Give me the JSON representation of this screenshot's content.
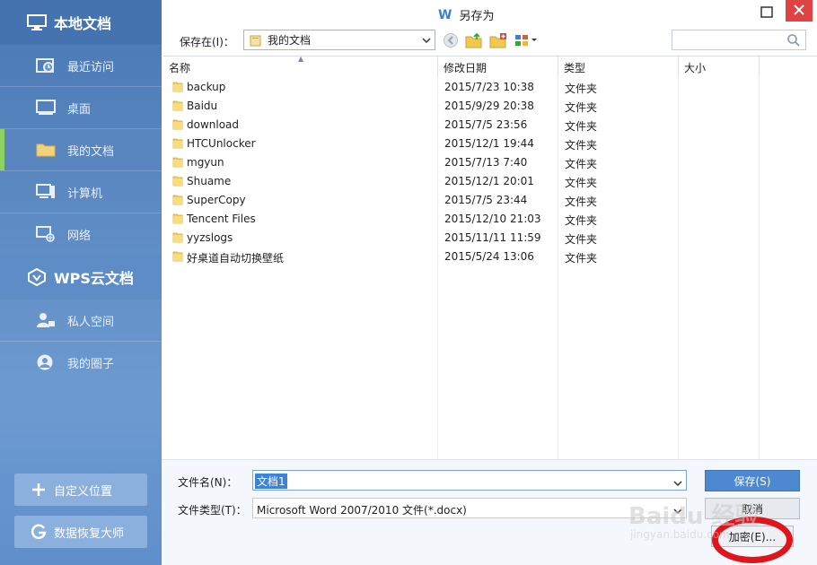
{
  "sidebar": {
    "local_title": "本地文档",
    "items": [
      {
        "label": "最近访问",
        "icon": "clock-icon"
      },
      {
        "label": "桌面",
        "icon": "monitor-icon"
      },
      {
        "label": "我的文档",
        "icon": "folder-icon",
        "active": true
      },
      {
        "label": "计算机",
        "icon": "computer-icon"
      },
      {
        "label": "网络",
        "icon": "network-icon"
      }
    ],
    "cloud_title": "WPS云文档",
    "cloud_items": [
      {
        "label": "私人空间",
        "icon": "user-lock-icon"
      },
      {
        "label": "我的圈子",
        "icon": "user-circle-icon"
      }
    ],
    "custom_location": "自定义位置",
    "data_recovery": "数据恢复大师"
  },
  "dialog": {
    "title": "另存为",
    "logo": "W"
  },
  "toolbar": {
    "save_in_label": "保存在(I)：",
    "current_folder": "我的文档"
  },
  "columns": {
    "name": "名称",
    "modified": "修改日期",
    "type": "类型",
    "size": "大小"
  },
  "files": [
    {
      "name": "backup",
      "modified": "2015/7/23 10:38",
      "type": "文件夹"
    },
    {
      "name": "Baidu",
      "modified": "2015/9/29 20:38",
      "type": "文件夹"
    },
    {
      "name": "download",
      "modified": "2015/7/5 23:56",
      "type": "文件夹"
    },
    {
      "name": "HTCUnlocker",
      "modified": "2015/12/1 19:44",
      "type": "文件夹"
    },
    {
      "name": "mgyun",
      "modified": "2015/7/13 7:40",
      "type": "文件夹"
    },
    {
      "name": "Shuame",
      "modified": "2015/12/1 20:01",
      "type": "文件夹"
    },
    {
      "name": "SuperCopy",
      "modified": "2015/7/5 23:44",
      "type": "文件夹"
    },
    {
      "name": "Tencent Files",
      "modified": "2015/12/10 21:03",
      "type": "文件夹"
    },
    {
      "name": "yyzslogs",
      "modified": "2015/11/11 11:59",
      "type": "文件夹"
    },
    {
      "name": "好桌道自动切换壁纸",
      "modified": "2015/5/24 13:06",
      "type": "文件夹"
    }
  ],
  "bottom": {
    "filename_label": "文件名(N)：",
    "filename_value": "文档1",
    "filetype_label": "文件类型(T)：",
    "filetype_value": "Microsoft Word 2007/2010 文件(*.docx)",
    "save_button": "保存(S)",
    "cancel_button": "取消",
    "encrypt_button": "加密(E)..."
  },
  "watermark": {
    "text": "Baidu 经验",
    "sub": "jingyan.baidu.com"
  },
  "colors": {
    "sidebar_bg": "#4a78b3",
    "active_marker": "#8dd35f",
    "save_button": "#4e88d0",
    "close_button": "#e04343",
    "highlight_ellipse": "#e0151c"
  }
}
